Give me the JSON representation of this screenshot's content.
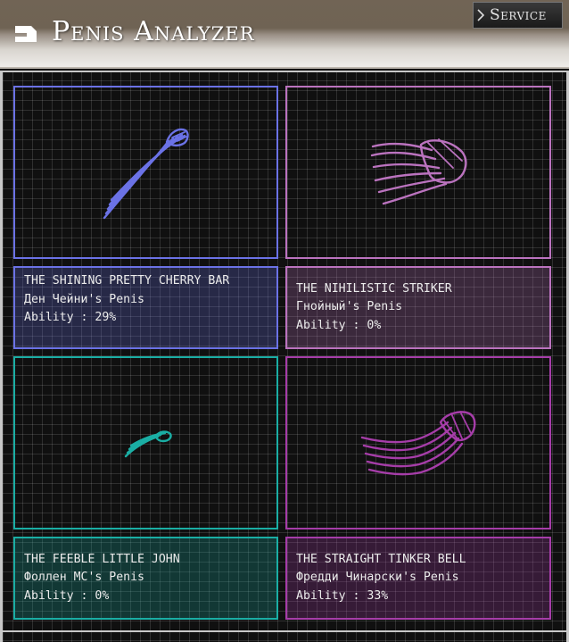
{
  "header": {
    "title": "Penis Analyzer",
    "service_label": "Service"
  },
  "colors": {
    "blue": "#6b72e6",
    "pink": "#bb73bf",
    "teal": "#1aaea4",
    "purple": "#a63da9"
  },
  "cards": [
    {
      "title": "THE SHINING PRETTY CHERRY BAR",
      "owner": "Ден Чейни's Penis",
      "ability": "Ability : 29%",
      "color": "blue"
    },
    {
      "title": "THE NIHILISTIC STRIKER",
      "owner": "Гнойный's Penis",
      "ability": "Ability : 0%",
      "color": "pink"
    },
    {
      "title": "THE FEEBLE LITTLE JOHN",
      "owner": "Фоллен MC's Penis",
      "ability": "Ability : 0%",
      "color": "teal"
    },
    {
      "title": "THE STRAIGHT TINKER BELL",
      "owner": "Фредди Чинарски's Penis",
      "ability": "Ability : 33%",
      "color": "purple"
    }
  ]
}
